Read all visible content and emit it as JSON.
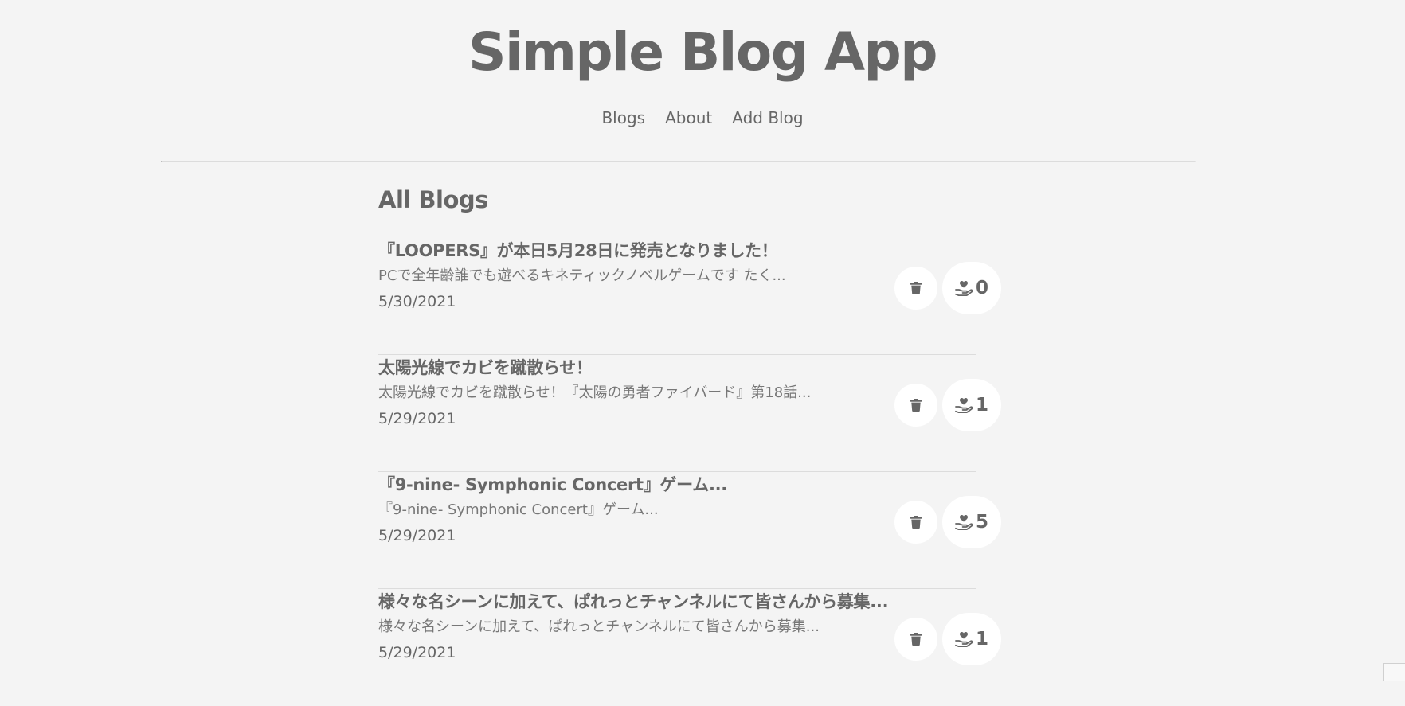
{
  "app": {
    "title": "Simple Blog App"
  },
  "nav": {
    "items": [
      {
        "label": "Blogs"
      },
      {
        "label": "About"
      },
      {
        "label": "Add Blog"
      }
    ]
  },
  "main": {
    "heading": "All Blogs",
    "blogs": [
      {
        "title": "『LOOPERS』が本日5月28日に発売となりました！",
        "snippet": "PCで全年齢誰でも遊べるキネティックノベルゲームです たく...",
        "date": "5/30/2021",
        "likes": "0"
      },
      {
        "title": "太陽光線でカビを蹴散らせ！",
        "snippet": "太陽光線でカビを蹴散らせ！『太陽の勇者ファイバード』第18話...",
        "date": "5/29/2021",
        "likes": "1"
      },
      {
        "title": "『9-nine- Symphonic Concert』ゲーム...",
        "snippet": "『9-nine- Symphonic Concert』ゲーム...",
        "date": "5/29/2021",
        "likes": "5"
      },
      {
        "title": "様々な名シーンに加えて、ぱれっとチャンネルにて皆さんから募集...",
        "snippet": "様々な名シーンに加えて、ぱれっとチャンネルにて皆さんから募集...",
        "date": "5/29/2021",
        "likes": "1"
      }
    ]
  },
  "icons": {
    "delete": "trash-icon",
    "like": "hand-heart-icon"
  },
  "colors": {
    "background": "#f4f4f4",
    "text": "#666666",
    "button": "#ffffff",
    "divider": "#dcdcdc"
  }
}
